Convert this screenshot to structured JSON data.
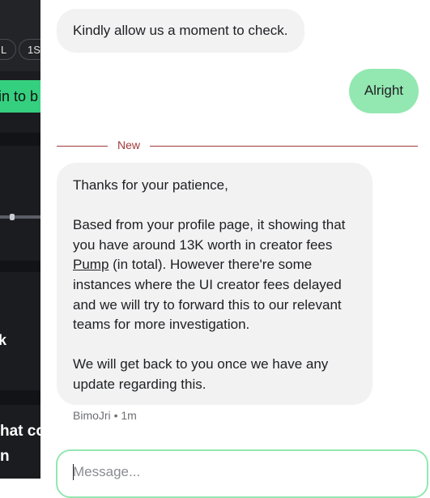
{
  "background_app": {
    "chips": [
      "L",
      "1S"
    ],
    "green_button_label": "in to b",
    "texts": [
      "k",
      "hat co",
      "n"
    ]
  },
  "chat": {
    "messages": [
      {
        "sender": "agent",
        "text": "Kindly allow us a moment to check."
      },
      {
        "sender": "user",
        "text": "Alright"
      }
    ],
    "divider_label": "New",
    "long_message": {
      "line1": "Thanks for your patience,",
      "para2_before": "Based from your profile page, it showing that you have around 13K worth in creator fees ",
      "para2_link": "Pump",
      "para2_after": " (in total). However there're some instances where the UI creator fees delayed and we will try to forward this to our relevant teams for more investigation.",
      "para3": "We will get back to you once we have any update regarding this."
    },
    "meta": {
      "author": "BimoJri",
      "separator": "•",
      "time": "1m"
    },
    "input": {
      "placeholder": "Message...",
      "value": ""
    }
  },
  "colors": {
    "user_bubble": "#93e7b1",
    "agent_bubble": "#f2f2f3",
    "divider": "#a33a3a",
    "input_border": "#93e7b1",
    "background_app": "#1b1c20",
    "green_button": "#35d07f"
  }
}
